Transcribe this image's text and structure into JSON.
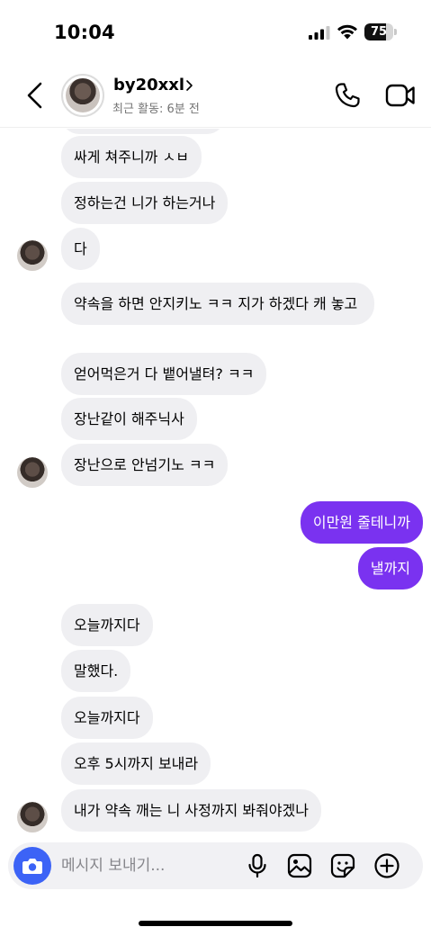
{
  "status_bar": {
    "time": "10:04",
    "battery_level": "75",
    "battery_fraction": 0.75
  },
  "header": {
    "username": "by20xxl",
    "activity": "최근 활동: 6분 전"
  },
  "messages": [
    {
      "side": "in",
      "text": "싸게 쳐주니까 ㅅㅂ"
    },
    {
      "side": "in",
      "text": "정하는건 니가 하는거나"
    },
    {
      "side": "in",
      "text": "다"
    },
    {
      "side": "in",
      "text": "약속을 하면 안지키노 ㅋㅋ 지가 하겠다 캐 놓고"
    },
    {
      "side": "in",
      "text": "얻어먹은거 다 뱉어낼텨? ㅋㅋ"
    },
    {
      "side": "in",
      "text": "장난같이 해주닉사"
    },
    {
      "side": "in",
      "text": "장난으로 안넘기노 ㅋㅋ"
    },
    {
      "side": "out",
      "text": "이만원 줄테니까"
    },
    {
      "side": "out",
      "text": "낼까지"
    },
    {
      "side": "in",
      "text": "오늘까지다"
    },
    {
      "side": "in",
      "text": "말했다."
    },
    {
      "side": "in",
      "text": "오늘까지다"
    },
    {
      "side": "in",
      "text": "오후 5시까지 보내라"
    },
    {
      "side": "in",
      "text": "내가 약속 깨는 니 사정까지 봐줘야겠나"
    }
  ],
  "composer": {
    "placeholder": "메시지 보내기..."
  },
  "colors": {
    "outgoing_bubble": "#7a32f0",
    "incoming_bubble": "#efeff2",
    "camera_button": "#3c63f6"
  },
  "icons": {
    "back": "chevron-left-icon",
    "call": "phone-icon",
    "video": "video-camera-icon",
    "camera": "camera-icon",
    "mic": "microphone-icon",
    "gallery": "image-icon",
    "sticker": "sticker-icon",
    "more": "plus-circle-icon"
  }
}
